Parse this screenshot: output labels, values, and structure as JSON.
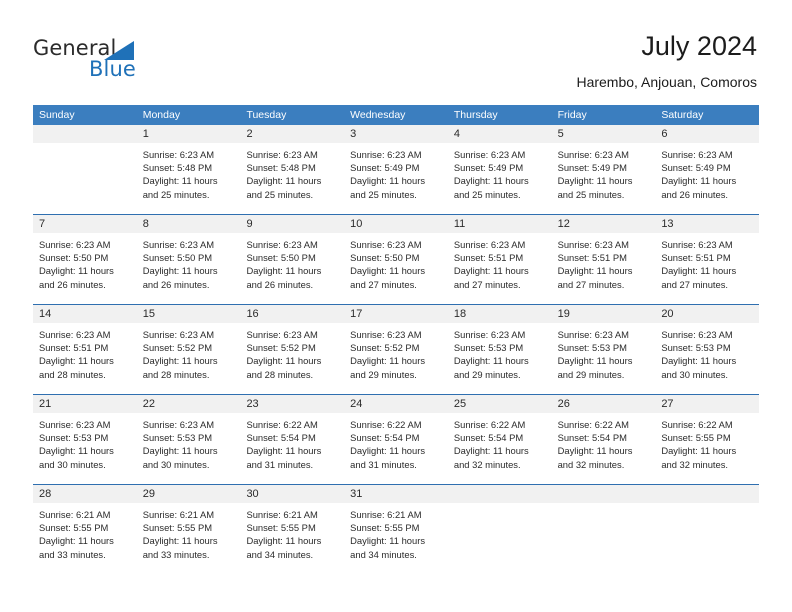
{
  "brand": {
    "name_top": "General",
    "name_bottom": "Blue",
    "accent_color": "#1f71b8",
    "triangle_icon": "triangle-icon"
  },
  "header": {
    "title": "July 2024",
    "subtitle": "Harembo, Anjouan, Comoros"
  },
  "calendar": {
    "header_bg": "#3b7ebf",
    "header_text_color": "#ffffff",
    "row_separator_color": "#2f6fb0",
    "day_band_bg": "#f1f1f1",
    "weekdays": [
      "Sunday",
      "Monday",
      "Tuesday",
      "Wednesday",
      "Thursday",
      "Friday",
      "Saturday"
    ],
    "weeks": [
      [
        {
          "day": "",
          "lines": []
        },
        {
          "day": "1",
          "lines": [
            "Sunrise: 6:23 AM",
            "Sunset: 5:48 PM",
            "Daylight: 11 hours",
            "and 25 minutes."
          ]
        },
        {
          "day": "2",
          "lines": [
            "Sunrise: 6:23 AM",
            "Sunset: 5:48 PM",
            "Daylight: 11 hours",
            "and 25 minutes."
          ]
        },
        {
          "day": "3",
          "lines": [
            "Sunrise: 6:23 AM",
            "Sunset: 5:49 PM",
            "Daylight: 11 hours",
            "and 25 minutes."
          ]
        },
        {
          "day": "4",
          "lines": [
            "Sunrise: 6:23 AM",
            "Sunset: 5:49 PM",
            "Daylight: 11 hours",
            "and 25 minutes."
          ]
        },
        {
          "day": "5",
          "lines": [
            "Sunrise: 6:23 AM",
            "Sunset: 5:49 PM",
            "Daylight: 11 hours",
            "and 25 minutes."
          ]
        },
        {
          "day": "6",
          "lines": [
            "Sunrise: 6:23 AM",
            "Sunset: 5:49 PM",
            "Daylight: 11 hours",
            "and 26 minutes."
          ]
        }
      ],
      [
        {
          "day": "7",
          "lines": [
            "Sunrise: 6:23 AM",
            "Sunset: 5:50 PM",
            "Daylight: 11 hours",
            "and 26 minutes."
          ]
        },
        {
          "day": "8",
          "lines": [
            "Sunrise: 6:23 AM",
            "Sunset: 5:50 PM",
            "Daylight: 11 hours",
            "and 26 minutes."
          ]
        },
        {
          "day": "9",
          "lines": [
            "Sunrise: 6:23 AM",
            "Sunset: 5:50 PM",
            "Daylight: 11 hours",
            "and 26 minutes."
          ]
        },
        {
          "day": "10",
          "lines": [
            "Sunrise: 6:23 AM",
            "Sunset: 5:50 PM",
            "Daylight: 11 hours",
            "and 27 minutes."
          ]
        },
        {
          "day": "11",
          "lines": [
            "Sunrise: 6:23 AM",
            "Sunset: 5:51 PM",
            "Daylight: 11 hours",
            "and 27 minutes."
          ]
        },
        {
          "day": "12",
          "lines": [
            "Sunrise: 6:23 AM",
            "Sunset: 5:51 PM",
            "Daylight: 11 hours",
            "and 27 minutes."
          ]
        },
        {
          "day": "13",
          "lines": [
            "Sunrise: 6:23 AM",
            "Sunset: 5:51 PM",
            "Daylight: 11 hours",
            "and 27 minutes."
          ]
        }
      ],
      [
        {
          "day": "14",
          "lines": [
            "Sunrise: 6:23 AM",
            "Sunset: 5:51 PM",
            "Daylight: 11 hours",
            "and 28 minutes."
          ]
        },
        {
          "day": "15",
          "lines": [
            "Sunrise: 6:23 AM",
            "Sunset: 5:52 PM",
            "Daylight: 11 hours",
            "and 28 minutes."
          ]
        },
        {
          "day": "16",
          "lines": [
            "Sunrise: 6:23 AM",
            "Sunset: 5:52 PM",
            "Daylight: 11 hours",
            "and 28 minutes."
          ]
        },
        {
          "day": "17",
          "lines": [
            "Sunrise: 6:23 AM",
            "Sunset: 5:52 PM",
            "Daylight: 11 hours",
            "and 29 minutes."
          ]
        },
        {
          "day": "18",
          "lines": [
            "Sunrise: 6:23 AM",
            "Sunset: 5:53 PM",
            "Daylight: 11 hours",
            "and 29 minutes."
          ]
        },
        {
          "day": "19",
          "lines": [
            "Sunrise: 6:23 AM",
            "Sunset: 5:53 PM",
            "Daylight: 11 hours",
            "and 29 minutes."
          ]
        },
        {
          "day": "20",
          "lines": [
            "Sunrise: 6:23 AM",
            "Sunset: 5:53 PM",
            "Daylight: 11 hours",
            "and 30 minutes."
          ]
        }
      ],
      [
        {
          "day": "21",
          "lines": [
            "Sunrise: 6:23 AM",
            "Sunset: 5:53 PM",
            "Daylight: 11 hours",
            "and 30 minutes."
          ]
        },
        {
          "day": "22",
          "lines": [
            "Sunrise: 6:23 AM",
            "Sunset: 5:53 PM",
            "Daylight: 11 hours",
            "and 30 minutes."
          ]
        },
        {
          "day": "23",
          "lines": [
            "Sunrise: 6:22 AM",
            "Sunset: 5:54 PM",
            "Daylight: 11 hours",
            "and 31 minutes."
          ]
        },
        {
          "day": "24",
          "lines": [
            "Sunrise: 6:22 AM",
            "Sunset: 5:54 PM",
            "Daylight: 11 hours",
            "and 31 minutes."
          ]
        },
        {
          "day": "25",
          "lines": [
            "Sunrise: 6:22 AM",
            "Sunset: 5:54 PM",
            "Daylight: 11 hours",
            "and 32 minutes."
          ]
        },
        {
          "day": "26",
          "lines": [
            "Sunrise: 6:22 AM",
            "Sunset: 5:54 PM",
            "Daylight: 11 hours",
            "and 32 minutes."
          ]
        },
        {
          "day": "27",
          "lines": [
            "Sunrise: 6:22 AM",
            "Sunset: 5:55 PM",
            "Daylight: 11 hours",
            "and 32 minutes."
          ]
        }
      ],
      [
        {
          "day": "28",
          "lines": [
            "Sunrise: 6:21 AM",
            "Sunset: 5:55 PM",
            "Daylight: 11 hours",
            "and 33 minutes."
          ]
        },
        {
          "day": "29",
          "lines": [
            "Sunrise: 6:21 AM",
            "Sunset: 5:55 PM",
            "Daylight: 11 hours",
            "and 33 minutes."
          ]
        },
        {
          "day": "30",
          "lines": [
            "Sunrise: 6:21 AM",
            "Sunset: 5:55 PM",
            "Daylight: 11 hours",
            "and 34 minutes."
          ]
        },
        {
          "day": "31",
          "lines": [
            "Sunrise: 6:21 AM",
            "Sunset: 5:55 PM",
            "Daylight: 11 hours",
            "and 34 minutes."
          ]
        },
        {
          "day": "",
          "lines": []
        },
        {
          "day": "",
          "lines": []
        },
        {
          "day": "",
          "lines": []
        }
      ]
    ]
  }
}
